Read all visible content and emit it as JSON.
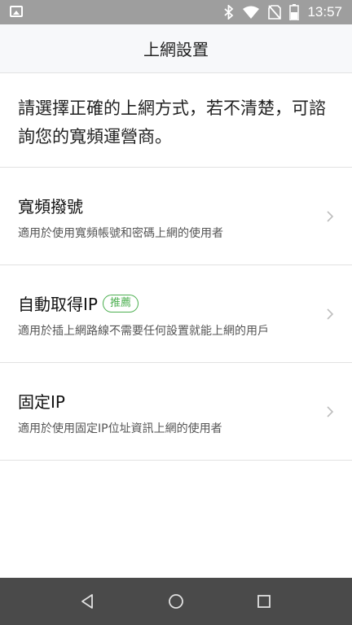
{
  "status_bar": {
    "time": "13:57",
    "icons": [
      "image-icon",
      "bluetooth-icon",
      "wifi-icon",
      "no-sim-icon",
      "battery-icon"
    ]
  },
  "header": {
    "title": "上網設置"
  },
  "intro": {
    "text": "請選擇正確的上網方式，若不清楚，可諮詢您的寬頻運營商。"
  },
  "options": [
    {
      "title": "寬頻撥號",
      "description": "適用於使用寬頻帳號和密碼上網的使用者"
    },
    {
      "title": "自動取得IP",
      "badge": "推薦",
      "description": "適用於插上網路線不需要任何設置就能上網的用戶"
    },
    {
      "title": "固定IP",
      "description": "適用於使用固定IP位址資訊上網的使用者"
    }
  ],
  "colors": {
    "accent_green": "#4caf50",
    "status_bar": "#9e9e9e",
    "nav_bar": "#4a4a4a",
    "header_bg": "#f7f8fa"
  },
  "nav_bar": {
    "icons": [
      "back-icon",
      "home-icon",
      "recent-apps-icon"
    ]
  }
}
